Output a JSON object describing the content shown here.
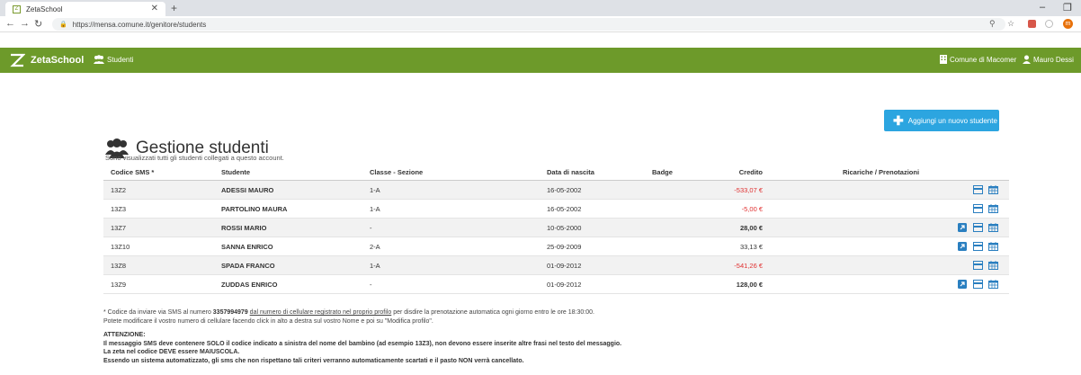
{
  "browser": {
    "tab_title": "ZetaSchool",
    "url": "https://mensa.comune.it/genitore/students"
  },
  "navbar": {
    "brand": "ZetaSchool",
    "studenti": "Studenti",
    "comune": "Comune di Macomer",
    "user": "Mauro Dessi"
  },
  "add_button": "Aggiungi un nuovo studente",
  "page": {
    "title": "Gestione studenti",
    "subtitle": "Sono visualizzati tutti gli studenti collegati a questo account."
  },
  "table": {
    "headers": {
      "sms": "Codice SMS *",
      "student": "Studente",
      "class": "Classe - Sezione",
      "dob": "Data di nascita",
      "badge": "Badge",
      "credit": "Credito",
      "ric": "Ricariche / Prenotazioni"
    },
    "rows": [
      {
        "sms": "13Z2",
        "student": "ADESSI MAURO",
        "class": "1-A",
        "dob": "16-05-2002",
        "credit": "-533,07 €"
      },
      {
        "sms": "13Z3",
        "student": "PARTOLINO MAURA",
        "class": "1-A",
        "dob": "16-05-2002",
        "credit": "-5,00 €"
      },
      {
        "sms": "13Z7",
        "student": "ROSSI MARIO",
        "class": "-",
        "dob": "10-05-2000",
        "credit": "28,00 €"
      },
      {
        "sms": "13Z10",
        "student": "SANNA ENRICO",
        "class": "2-A",
        "dob": "25-09-2009",
        "credit": "33,13 €"
      },
      {
        "sms": "13Z8",
        "student": "SPADA FRANCO",
        "class": "1-A",
        "dob": "01-09-2012",
        "credit": "-541,26 €"
      },
      {
        "sms": "13Z9",
        "student": "ZUDDAS ENRICO",
        "class": "-",
        "dob": "01-09-2012",
        "credit": "128,00 €"
      }
    ]
  },
  "notes": {
    "line1_a": "* Codice da inviare via SMS al numero ",
    "line1_phone": "3357994979",
    "line1_link": "dal numero di cellulare registrato nel proprio profilo",
    "line1_b": " per disdire la prenotazione automatica ogni giorno entro le ore 18:30:00.",
    "line2": "Potete modificare il vostro numero di cellulare facendo click in alto a destra sul vostro Nome e poi su \"Modifica profilo\".",
    "att_title": "ATTENZIONE:",
    "att1": "Il messaggio SMS deve contenere SOLO il codice indicato a sinistra del nome del bambino (ad esempio 13Z3), non devono essere inserite altre frasi nel testo del messaggio.",
    "att2": "La zeta nel codice DEVE essere MAIUSCOLA.",
    "att3": "Essendo un sistema automatizzato, gli sms che non rispettano tali criteri verranno automaticamente scartati e il pasto NON verrà cancellato."
  },
  "colors": {
    "navbar": "#6d9a2a",
    "button": "#2ca5e0",
    "negative_credit": "#e03030",
    "icon_blue": "#2a7fc0"
  }
}
